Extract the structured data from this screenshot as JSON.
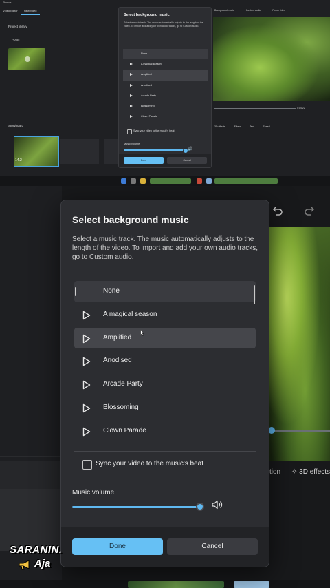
{
  "top_screenshot": {
    "app_title": "Photos",
    "tabs": [
      "Video Editor",
      "New video"
    ],
    "library_title": "Project library",
    "library_add": "+ Add",
    "storyboard_title": "Storyboard",
    "clip_duration": "14.2",
    "topbar_actions": [
      "Background music",
      "Custom audio",
      "Finish video"
    ],
    "seek_time": "0:14.22",
    "tool_row": [
      "3D effects",
      "Filters",
      "Text",
      "Speed"
    ],
    "dialog": {
      "title": "Select background music",
      "description": "Select a music track. The music automatically adjusts to the length of the video. To import and add your own audio tracks, go to Custom audio.",
      "tracks": [
        "None",
        "A magical season",
        "Amplified",
        "Anodised",
        "Arcade Party",
        "Blossoming",
        "Clown Parade"
      ],
      "sync_label": "Sync your video to the music's beat",
      "volume_label": "Music volume",
      "done_label": "Done",
      "cancel_label": "Cancel"
    }
  },
  "dialog": {
    "title": "Select background music",
    "description": "Select a music track. The music automatically adjusts to the length of the video. To import and add your own audio tracks, go to Custom audio.",
    "selected_track": "None",
    "hovered_track": "Amplified",
    "tracks": [
      {
        "label": "None"
      },
      {
        "label": "A magical season"
      },
      {
        "label": "Amplified"
      },
      {
        "label": "Anodised"
      },
      {
        "label": "Arcade Party"
      },
      {
        "label": "Blossoming"
      },
      {
        "label": "Clown Parade"
      }
    ],
    "sync_label": "Sync your video to the music's beat",
    "sync_checked": false,
    "volume_label": "Music volume",
    "volume_level": 0.9,
    "done_label": "Done",
    "cancel_label": "Cancel"
  },
  "background": {
    "tool_motion": "tion",
    "tool_3d": "3D effects"
  },
  "watermark": {
    "line1": "SARANIN.",
    "line2": "Aja"
  },
  "colors": {
    "accent": "#66c0f4",
    "dialog_bg": "#2c2d31",
    "selected_row": "#3a3b40",
    "hovered_row": "#45464b"
  }
}
